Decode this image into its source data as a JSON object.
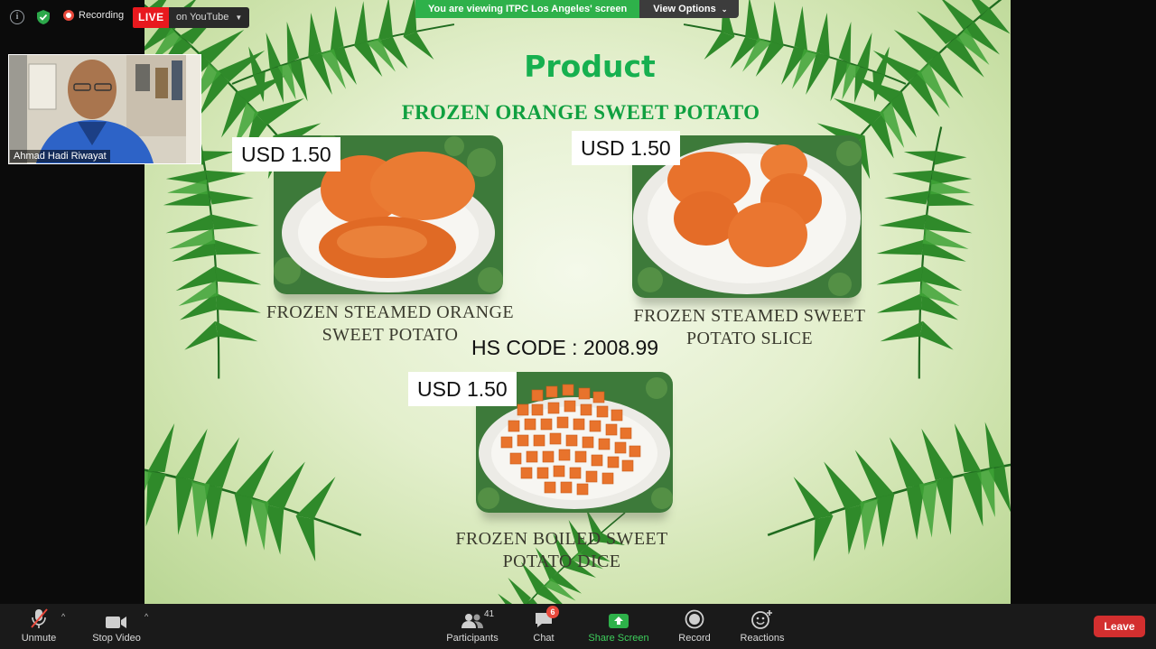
{
  "top_bar": {
    "recording_label": "Recording",
    "live_label": "LIVE",
    "live_destination": "on YouTube",
    "share_banner": "You are viewing ITPC Los Angeles' screen",
    "view_options": "View Options"
  },
  "participant_tile": {
    "name": "Ahmad Hadi Riwayat"
  },
  "slide": {
    "title": "Product",
    "subtitle": "FROZEN ORANGE SWEET POTATO",
    "hs_code": "HS CODE : 2008.99",
    "products": [
      {
        "name_line1": "FROZEN STEAMED ORANGE",
        "name_line2": "SWEET POTATO",
        "price": "USD 1.50"
      },
      {
        "name_line1": "FROZEN STEAMED SWEET",
        "name_line2": "POTATO SLICE",
        "price": "USD 1.50"
      },
      {
        "name_line1": "FROZEN BOILED SWEET",
        "name_line2": "POTATO DICE",
        "price": "USD 1.50"
      }
    ]
  },
  "toolbar": {
    "unmute": "Unmute",
    "stop_video": "Stop Video",
    "participants": "Participants",
    "participants_count": "41",
    "chat": "Chat",
    "chat_badge": "6",
    "share_screen": "Share Screen",
    "record": "Record",
    "reactions": "Reactions",
    "leave": "Leave"
  },
  "colors": {
    "live_red": "#e8191e",
    "share_green": "#2eb14a",
    "title_green": "#16b04f",
    "leave_red": "#d32f2f",
    "toolbar_bg": "#1a1a1a"
  }
}
